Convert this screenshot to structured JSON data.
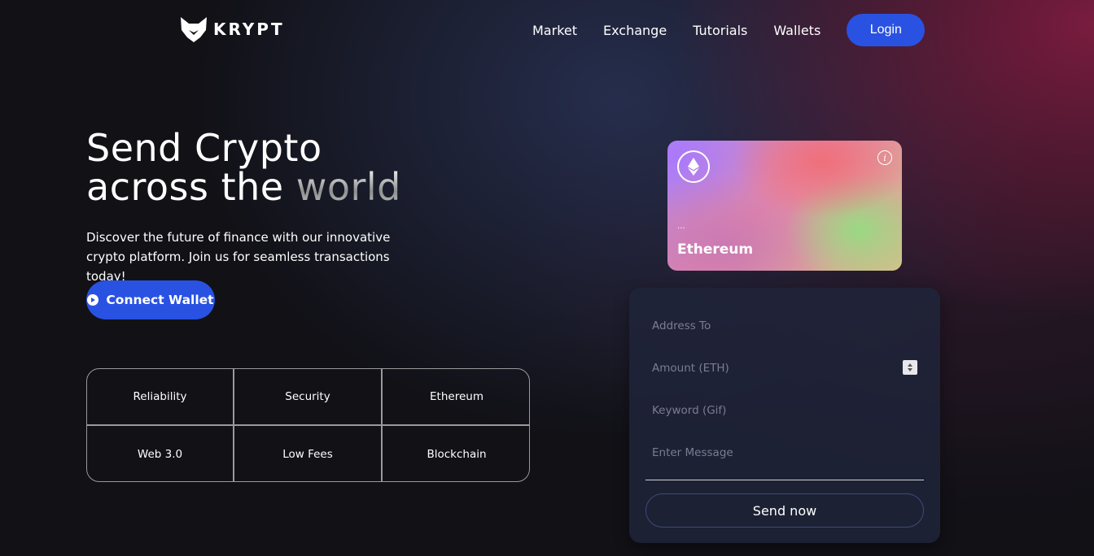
{
  "header": {
    "logo_text": "KRYPT",
    "nav": [
      "Market",
      "Exchange",
      "Tutorials",
      "Wallets"
    ],
    "login_label": "Login"
  },
  "hero": {
    "title_line1": "Send Crypto",
    "title_line2_a": "across the",
    "title_line2_b": "world",
    "subtitle": "Discover the future of finance with our innovative crypto platform. Join us for seamless transactions today!",
    "connect_label": "Connect Wallet"
  },
  "features": [
    "Reliability",
    "Security",
    "Ethereum",
    "Web 3.0",
    "Low Fees",
    "Blockchain"
  ],
  "card": {
    "address": "...",
    "name": "Ethereum",
    "info_glyph": "i"
  },
  "form": {
    "address_placeholder": "Address To",
    "amount_placeholder": "Amount (ETH)",
    "keyword_placeholder": "Keyword (Gif)",
    "message_placeholder": "Enter Message",
    "send_label": "Send now"
  },
  "colors": {
    "accent": "#2952e3",
    "background": "#111116"
  },
  "icons": [
    "fox-logo-icon",
    "play-icon",
    "ethereum-icon",
    "info-icon",
    "stepper-icon"
  ]
}
